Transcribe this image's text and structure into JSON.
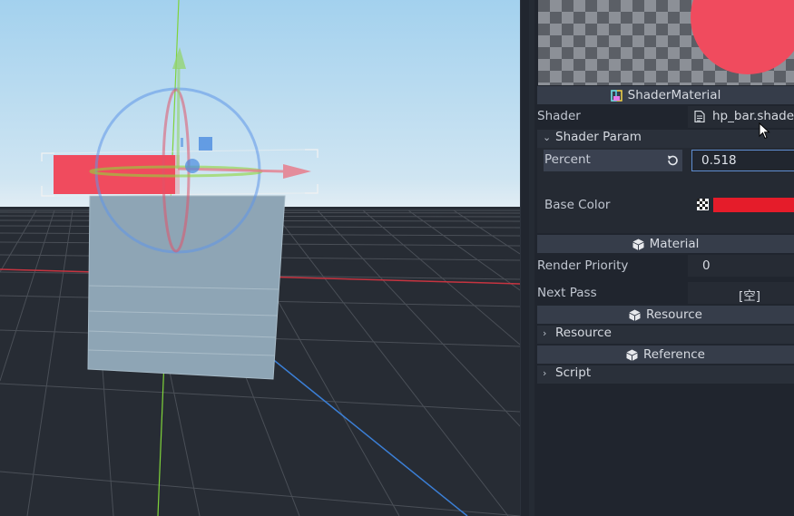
{
  "inspector": {
    "shader_material_title": "ShaderMaterial",
    "shader_label": "Shader",
    "shader_value": "hp_bar.shade",
    "shader_param_group": "Shader Param",
    "percent_label": "Percent",
    "percent_value": "0.518",
    "base_color_label": "Base Color",
    "base_color": "#e51c2a",
    "material_section": "Material",
    "render_priority_label": "Render Priority",
    "render_priority_value": "0",
    "next_pass_label": "Next Pass",
    "next_pass_value": "[空]",
    "resource_section": "Resource",
    "resource_group": "Resource",
    "reference_section": "Reference",
    "script_group": "Script"
  },
  "colors": {
    "sky_top": "#a8d4ef",
    "sky_horizon": "#dbeaf3",
    "ground": "#272c34",
    "hp_bar": "#f04b5e",
    "accent_blue": "#5f8ed2"
  },
  "icons": {
    "shader_material": "shader-material-icon",
    "shader_file": "file-icon",
    "revert": "revert-icon",
    "gradient": "checker-icon",
    "resource_cube": "cube-icon"
  }
}
